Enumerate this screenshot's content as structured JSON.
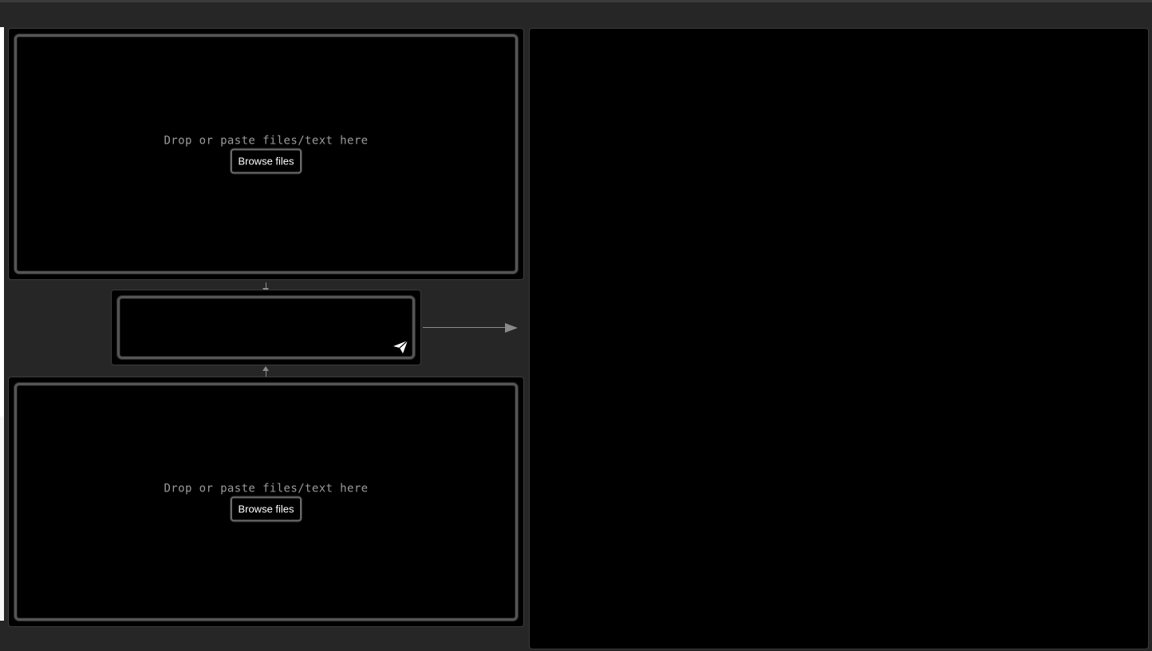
{
  "input_top": {
    "drop_text": "Drop or paste files/text here",
    "browse_label": "Browse files"
  },
  "prompt_box": {
    "value": "",
    "send_icon": "paper-plane-icon"
  },
  "input_bottom": {
    "drop_text": "Drop or paste files/text here",
    "browse_label": "Browse files"
  },
  "output": {
    "content": ""
  },
  "colors": {
    "background": "#262626",
    "panel": "#000000",
    "panel_border": "#555555",
    "text_muted": "#9a9a9a",
    "arrow": "#8a8a8a"
  }
}
